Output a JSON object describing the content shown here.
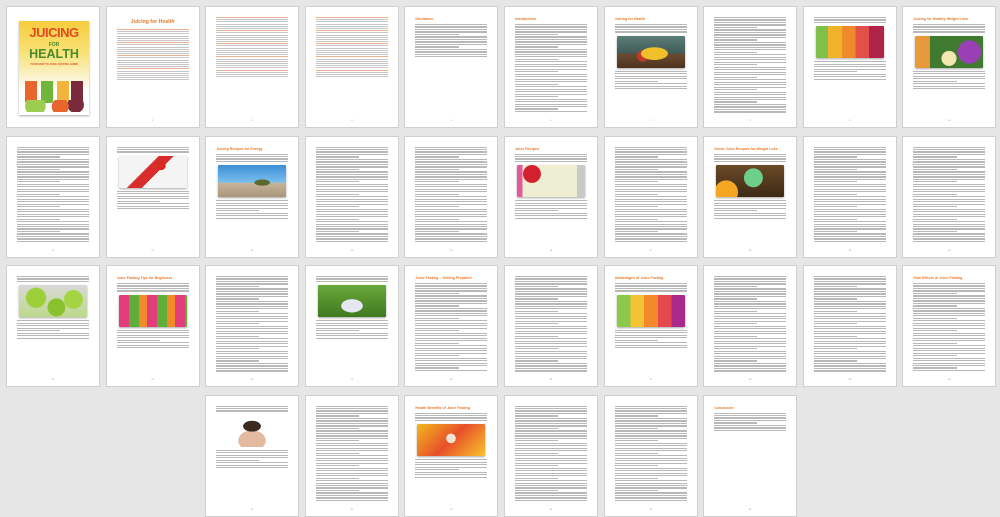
{
  "document": {
    "title": "Juicing for Health",
    "view": "multi-page thumbnail grid",
    "accent_color": "#e8792a",
    "page_count": 36
  },
  "cover": {
    "title_line1": "JUICING",
    "title_line2": "FOR",
    "title_line3": "HEALTH",
    "subtitle": "YOUR HOW TO JUICE FASTING GUIDE"
  },
  "pages": [
    {
      "kind": "cover"
    },
    {
      "kind": "toc",
      "heading": "Juicing for Health",
      "number": "2"
    },
    {
      "kind": "toc2",
      "number": "3"
    },
    {
      "kind": "toc3",
      "number": "4"
    },
    {
      "kind": "text",
      "heading": "Disclaimer",
      "number": "5"
    },
    {
      "kind": "text",
      "heading": "Introduction",
      "number": "6"
    },
    {
      "kind": "image",
      "heading": "Juicing for Health",
      "image": "bananas",
      "number": "7"
    },
    {
      "kind": "text",
      "heading": "",
      "number": "8"
    },
    {
      "kind": "image",
      "heading": "",
      "image": "bottles",
      "number": "9"
    },
    {
      "kind": "image",
      "heading": "Juicing for Healthy Weight Loss",
      "image": "greens",
      "number": "10"
    },
    {
      "kind": "text",
      "heading": "",
      "number": "11"
    },
    {
      "kind": "image",
      "heading": "",
      "image": "note",
      "number": "12"
    },
    {
      "kind": "image",
      "heading": "Juicing Recipes for Energy",
      "image": "beach",
      "number": "13"
    },
    {
      "kind": "text",
      "heading": "",
      "number": "14"
    },
    {
      "kind": "text",
      "heading": "",
      "number": "15"
    },
    {
      "kind": "image",
      "heading": "Juice Recipes",
      "image": "board",
      "number": "16"
    },
    {
      "kind": "text",
      "heading": "",
      "number": "17"
    },
    {
      "kind": "image",
      "heading": "Green Juice Recipes for Weight Loss",
      "image": "smoothie",
      "number": "18"
    },
    {
      "kind": "text",
      "heading": "",
      "number": "19"
    },
    {
      "kind": "text",
      "heading": "",
      "number": "20"
    },
    {
      "kind": "image",
      "heading": "",
      "image": "apples",
      "number": "21"
    },
    {
      "kind": "image",
      "heading": "Juice Fasting Tips for Beginners",
      "image": "market",
      "number": "22"
    },
    {
      "kind": "text",
      "heading": "",
      "number": "23"
    },
    {
      "kind": "image",
      "heading": "",
      "image": "garden",
      "number": "24"
    },
    {
      "kind": "text",
      "heading": "Juice Fasting – Getting Prepared",
      "number": "25"
    },
    {
      "kind": "text",
      "heading": "",
      "number": "26"
    },
    {
      "kind": "image",
      "heading": "Advantages of Juice Fasting",
      "image": "jars",
      "number": "27"
    },
    {
      "kind": "text",
      "heading": "",
      "number": "28"
    },
    {
      "kind": "text",
      "heading": "",
      "number": "29"
    },
    {
      "kind": "text",
      "heading": "Side Effects of Juice Fasting",
      "number": "30"
    },
    {
      "kind": "image",
      "heading": "",
      "image": "woman",
      "number": "31"
    },
    {
      "kind": "text",
      "heading": "",
      "number": "32"
    },
    {
      "kind": "image",
      "heading": "Health Benefits of Juice Fasting",
      "image": "fruit",
      "number": "33"
    },
    {
      "kind": "text",
      "heading": "",
      "number": "34"
    },
    {
      "kind": "text",
      "heading": "",
      "number": "35"
    },
    {
      "kind": "text",
      "heading": "Conclusion",
      "number": "36"
    }
  ]
}
